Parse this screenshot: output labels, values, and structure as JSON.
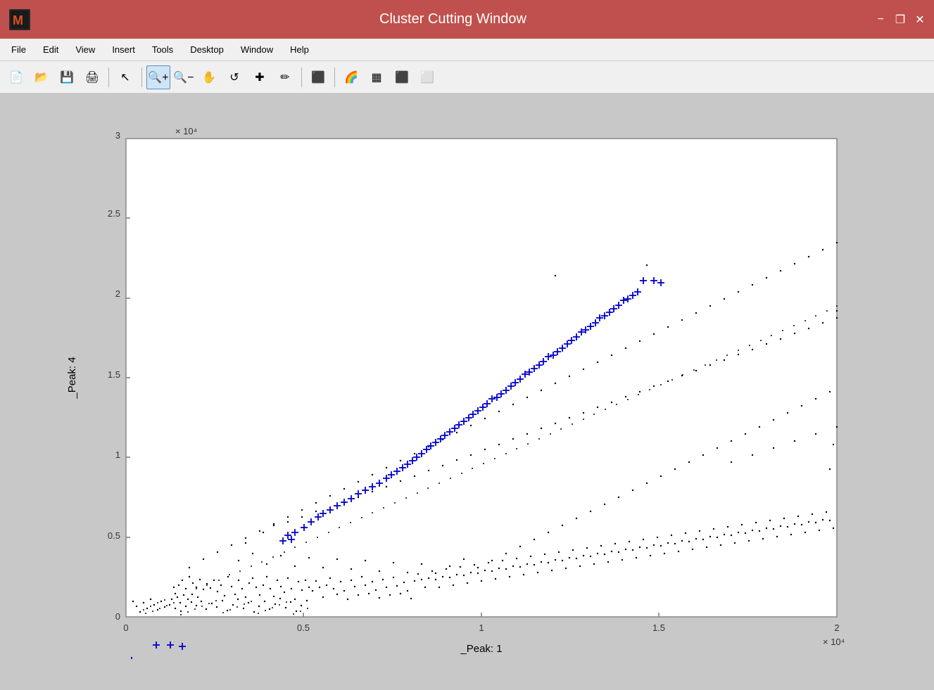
{
  "title_bar": {
    "title": "Cluster Cutting Window",
    "minimize_label": "−",
    "restore_label": "❐",
    "close_label": "✕"
  },
  "menu_bar": {
    "items": [
      {
        "label": "File",
        "id": "file"
      },
      {
        "label": "Edit",
        "id": "edit"
      },
      {
        "label": "View",
        "id": "view"
      },
      {
        "label": "Insert",
        "id": "insert"
      },
      {
        "label": "Tools",
        "id": "tools"
      },
      {
        "label": "Desktop",
        "id": "desktop"
      },
      {
        "label": "Window",
        "id": "window"
      },
      {
        "label": "Help",
        "id": "help"
      }
    ]
  },
  "toolbar": {
    "buttons": [
      {
        "id": "new",
        "icon": "📄",
        "title": "New"
      },
      {
        "id": "open",
        "icon": "📂",
        "title": "Open"
      },
      {
        "id": "save",
        "icon": "💾",
        "title": "Save"
      },
      {
        "id": "print",
        "icon": "🖨",
        "title": "Print"
      },
      {
        "id": "pointer",
        "icon": "↖",
        "title": "Pointer"
      },
      {
        "id": "zoom-in",
        "icon": "🔍+",
        "title": "Zoom In",
        "active": true
      },
      {
        "id": "zoom-out",
        "icon": "🔍−",
        "title": "Zoom Out"
      },
      {
        "id": "pan",
        "icon": "✋",
        "title": "Pan"
      },
      {
        "id": "rotate",
        "icon": "↺",
        "title": "Rotate"
      },
      {
        "id": "data-cursor",
        "icon": "✚",
        "title": "Data Cursor"
      },
      {
        "id": "brush",
        "icon": "✏",
        "title": "Brush"
      },
      {
        "id": "link-axes",
        "icon": "⬛",
        "title": "Link Axes"
      },
      {
        "id": "colorbar",
        "icon": "🌈",
        "title": "Colorbar"
      },
      {
        "id": "legend",
        "icon": "▦",
        "title": "Legend"
      },
      {
        "id": "hide",
        "icon": "⬛",
        "title": "Hide"
      },
      {
        "id": "show-axes",
        "icon": "⬜",
        "title": "Show Axes"
      }
    ]
  },
  "chart": {
    "title": "",
    "x_axis_label": "_Peak: 1",
    "y_axis_label": "_Peak: 4",
    "x_scale_label": "× 10⁴",
    "y_scale_label": "× 10⁴",
    "x_ticks": [
      "0",
      "0.5",
      "1",
      "1.5",
      "2"
    ],
    "y_ticks": [
      "0",
      "0.5",
      "1",
      "1.5",
      "2",
      "2.5",
      "3"
    ],
    "colors": {
      "black_dots": "#000000",
      "blue_crosses": "#0000cc",
      "plot_bg": "#ffffff",
      "grid_color": "#e0e0e0"
    }
  }
}
